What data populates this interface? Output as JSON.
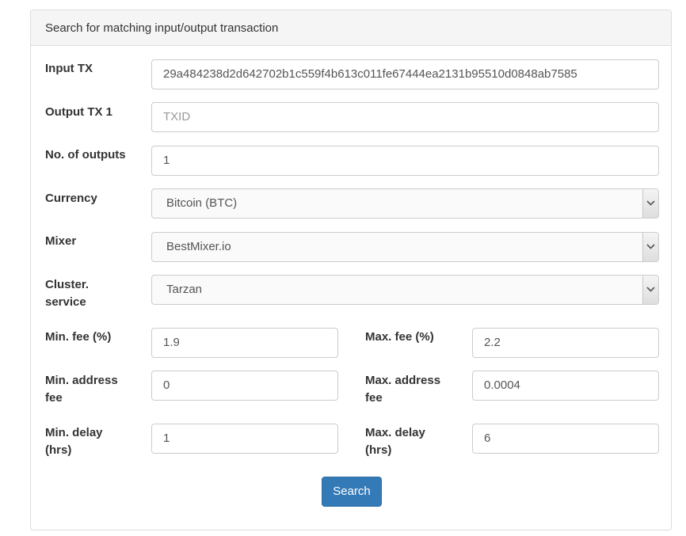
{
  "panel": {
    "title": "Search for matching input/output transaction"
  },
  "form": {
    "input_tx": {
      "label": "Input TX",
      "value": "29a484238d2d642702b1c559f4b613c011fe67444ea2131b95510d0848ab7585"
    },
    "output_tx": {
      "label": "Output TX 1",
      "placeholder": "TXID",
      "value": ""
    },
    "num_outputs": {
      "label": "No. of outputs",
      "value": "1"
    },
    "currency": {
      "label": "Currency",
      "selected": "Bitcoin (BTC)"
    },
    "mixer": {
      "label": "Mixer",
      "selected": "BestMixer.io"
    },
    "cluster_service": {
      "label_line1": "Cluster.",
      "label_line2": "service",
      "selected": "Tarzan"
    },
    "min_fee": {
      "label": "Min. fee (%)",
      "value": "1.9"
    },
    "max_fee": {
      "label": "Max. fee (%)",
      "value": "2.2"
    },
    "min_address_fee": {
      "label_line1": "Min. address",
      "label_line2": "fee",
      "value": "0"
    },
    "max_address_fee": {
      "label_line1": "Max. address",
      "label_line2": "fee",
      "value": "0.0004"
    },
    "min_delay": {
      "label_line1": "Min. delay",
      "label_line2": "(hrs)",
      "value": "1"
    },
    "max_delay": {
      "label_line1": "Max. delay",
      "label_line2": "(hrs)",
      "value": "6"
    },
    "search_label": "Search"
  },
  "icons": {
    "select_arrow": "chevron-down-icon"
  },
  "colors": {
    "primary": "#337ab7",
    "border": "#cccccc",
    "heading_bg": "#f5f5f5"
  }
}
